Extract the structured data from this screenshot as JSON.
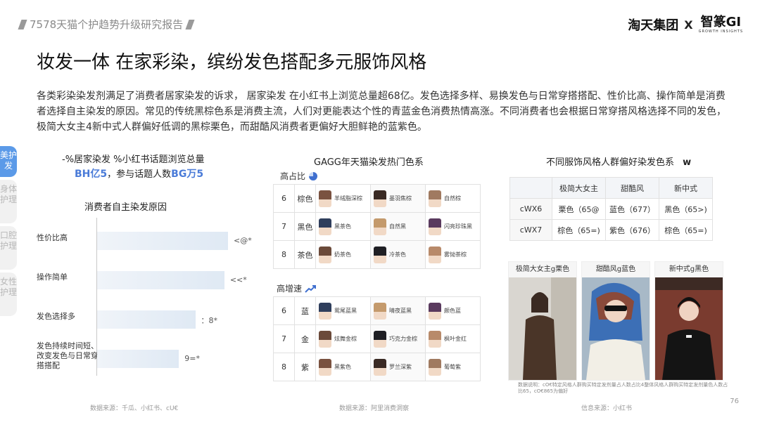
{
  "header": {
    "report_title": "7578天猫个护趋势升级研究报告",
    "brand_left": "淘天集团",
    "brand_x": "X",
    "brand_right": "智篆GI",
    "brand_sub": "GROWTH INSIGHTS"
  },
  "title": "妆发一体 在家彩染，缤纷发色搭配多元服饰风格",
  "intro": "各类彩染染发剂满足了消费者居家染发的诉求， 居家染发 在小红书上浏览总量超68亿。发色选择多样、易换发色与日常穿搭搭配、性价比高、操作简单是消费者选择自主染发的原因。常见的传统黑棕色系是消费主流，人们对更能表达个性的青蓝金色消费热情高涨。不同消费者也会根据日常穿搭风格选择不同的发色，极简大女主4新中式人群偏好低调的黑棕栗色，而甜酷风消费者更偏好大胆鲜艳的蓝紫色。",
  "sidebar": {
    "tabs": [
      "美护发",
      "身体护理",
      "口腔护理",
      "女性护理"
    ]
  },
  "section1": {
    "line1": "-%居家染发 %小红书话题浏览总量",
    "line2_a": "BH亿5",
    "line2_b": "，参与话题人数",
    "line2_c": "BG万5",
    "subtitle": "消费者自主染发原因",
    "source": "数据来源：千瓜、小红书、cU€"
  },
  "chart_data": {
    "type": "bar",
    "title": "消费者自主染发原因",
    "categories": [
      "性价比高",
      "操作简单",
      "发色选择多",
      "发色持续时间短、改变发色与日常穿搭搭配"
    ],
    "value_labels": [
      "<@*",
      "<<*",
      "：8*",
      "9=*"
    ],
    "values": [
      0.72,
      0.7,
      0.54,
      0.45
    ],
    "orientation": "horizontal"
  },
  "section2": {
    "title": "GAGG年天猫染发热门色系",
    "high_share_label": "高占比",
    "high_growth_label": "高增速",
    "high_share": [
      {
        "rank": "6",
        "color": "棕色",
        "items": [
          "羊绒脂深棕",
          "墨羽焦棕",
          "自然棕"
        ]
      },
      {
        "rank": "7",
        "color": "黑色",
        "items": [
          "黑茶色",
          "自然黑",
          "闪亮珍珠黑"
        ]
      },
      {
        "rank": "8",
        "color": "茶色",
        "items": [
          "奶茶色",
          "冷茶色",
          "雾恸茶棕"
        ]
      }
    ],
    "high_growth": [
      {
        "rank": "6",
        "color": "蓝",
        "items": [
          "鸳尾蓝黑",
          "晴夜蓝黑",
          "颇色蓝"
        ]
      },
      {
        "rank": "7",
        "color": "金",
        "items": [
          "炫舞金棕",
          "巧克力金棕",
          "枫叶金红"
        ]
      },
      {
        "rank": "8",
        "color": "紫",
        "items": [
          "黑紫色",
          "罗兰深紫",
          "葡萄紫"
        ]
      }
    ],
    "source": "数据来源：阿里消费洞察"
  },
  "section3": {
    "title": "不同服饰风格人群偏好染发色系",
    "title_icon_label": "w",
    "columns": [
      "极简大女主",
      "甜酷风",
      "新中式"
    ],
    "rows": [
      {
        "label": "cWX6",
        "values": [
          "栗色（65@",
          "蓝色（677）",
          "黑色（65>)"
        ]
      },
      {
        "label": "cWX7",
        "values": [
          "棕色（65=)",
          "紫色（676）",
          "棕色（65=)"
        ]
      }
    ],
    "photos": [
      "极简大女主g栗色",
      "甜酷风g蓝色",
      "新中式g黑色"
    ],
    "note": "数据说明：cO€特定风格人群购买特定发剂量占人数占比4整体风格人群购买特定发剂量色人数占比65，cO€865为偏好",
    "source": "信息来源：小红书"
  },
  "page_number": "76",
  "colors": {
    "accent": "#4a7bd8",
    "tab_active": "#5b9ae8"
  }
}
